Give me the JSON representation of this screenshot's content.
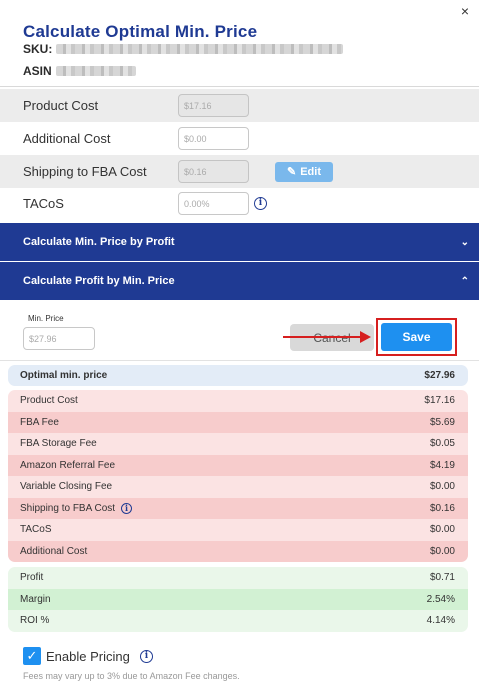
{
  "header": {
    "title": "Calculate Optimal Min. Price",
    "sku_label": "SKU:",
    "asin_label": "ASIN",
    "close_icon": "×"
  },
  "costs_form": [
    {
      "label": "Product Cost",
      "value": "$17.16",
      "disabled": true
    },
    {
      "label": "Additional Cost",
      "placeholder": "$0.00",
      "disabled": false
    },
    {
      "label": "Shipping to FBA Cost",
      "value": "$0.16",
      "disabled": true
    },
    {
      "label": "TACoS",
      "placeholder": "0.00%",
      "disabled": false
    }
  ],
  "edit_button": {
    "icon": "pencil-icon",
    "label": "Edit"
  },
  "sections": {
    "by_profit": "Calculate Min. Price by Profit",
    "by_min_price": "Calculate Profit by Min. Price"
  },
  "min_price": {
    "label": "Min. Price",
    "placeholder": "$27.96"
  },
  "buttons": {
    "cancel": "Cancel",
    "save": "Save"
  },
  "summary": {
    "optimal": {
      "label": "Optimal min. price",
      "value": "$27.96"
    },
    "costs": [
      {
        "label": "Product Cost",
        "value": "$17.16"
      },
      {
        "label": "FBA Fee",
        "value": "$5.69"
      },
      {
        "label": "FBA Storage Fee",
        "value": "$0.05"
      },
      {
        "label": "Amazon Referral Fee",
        "value": "$4.19"
      },
      {
        "label": "Variable Closing Fee",
        "value": "$0.00"
      },
      {
        "label": "Shipping to FBA Cost",
        "value": "$0.16"
      },
      {
        "label": "TACoS",
        "value": "$0.00"
      },
      {
        "label": "Additional Cost",
        "value": "$0.00"
      }
    ],
    "profit": [
      {
        "label": "Profit",
        "value": "$0.71"
      },
      {
        "label": "Margin",
        "value": "2.54%"
      },
      {
        "label": "ROI %",
        "value": "4.14%"
      }
    ]
  },
  "enable_pricing": {
    "label": "Enable Pricing",
    "checked": true
  },
  "note": "Fees may vary up to 3% due to Amazon Fee changes.",
  "colors": {
    "primary": "#1f3a93",
    "save": "#1e90f0",
    "highlight": "#d61f1f"
  }
}
